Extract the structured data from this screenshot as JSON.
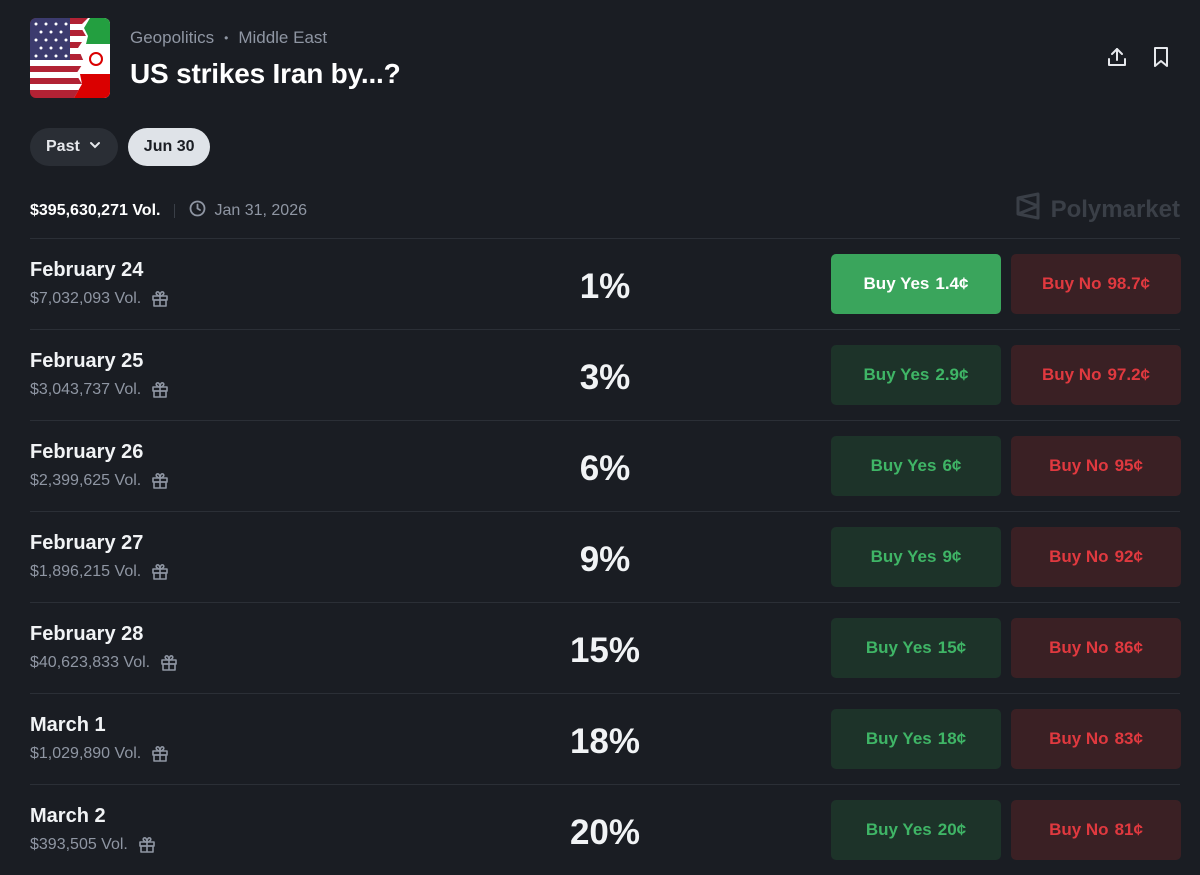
{
  "header": {
    "category": "Geopolitics",
    "subcategory": "Middle East",
    "title": "US strikes Iran by...?"
  },
  "filters": {
    "past_label": "Past",
    "date_label": "Jun 30"
  },
  "meta": {
    "volume": "$395,630,271 Vol.",
    "end_date": "Jan 31, 2026",
    "brand": "Polymarket"
  },
  "icons": [
    "share-icon",
    "bookmark-icon",
    "chevron-down-icon",
    "clock-icon",
    "gift-icon",
    "polymarket-logo-icon"
  ],
  "colors": {
    "background": "#1a1d23",
    "yes_text": "#3fb566",
    "yes_active_bg": "#3aa55c",
    "no_text": "#e0393f"
  },
  "markets": [
    {
      "date": "February 24",
      "volume": "$7,032,093 Vol.",
      "percent": "1%",
      "yes_label": "Buy Yes",
      "yes_price": "1.4¢",
      "no_label": "Buy No",
      "no_price": "98.7¢"
    },
    {
      "date": "February 25",
      "volume": "$3,043,737 Vol.",
      "percent": "3%",
      "yes_label": "Buy Yes",
      "yes_price": "2.9¢",
      "no_label": "Buy No",
      "no_price": "97.2¢"
    },
    {
      "date": "February 26",
      "volume": "$2,399,625 Vol.",
      "percent": "6%",
      "yes_label": "Buy Yes",
      "yes_price": "6¢",
      "no_label": "Buy No",
      "no_price": "95¢"
    },
    {
      "date": "February 27",
      "volume": "$1,896,215 Vol.",
      "percent": "9%",
      "yes_label": "Buy Yes",
      "yes_price": "9¢",
      "no_label": "Buy No",
      "no_price": "92¢"
    },
    {
      "date": "February 28",
      "volume": "$40,623,833 Vol.",
      "percent": "15%",
      "yes_label": "Buy Yes",
      "yes_price": "15¢",
      "no_label": "Buy No",
      "no_price": "86¢"
    },
    {
      "date": "March 1",
      "volume": "$1,029,890 Vol.",
      "percent": "18%",
      "yes_label": "Buy Yes",
      "yes_price": "18¢",
      "no_label": "Buy No",
      "no_price": "83¢"
    },
    {
      "date": "March 2",
      "volume": "$393,505 Vol.",
      "percent": "20%",
      "yes_label": "Buy Yes",
      "yes_price": "20¢",
      "no_label": "Buy No",
      "no_price": "81¢"
    }
  ]
}
